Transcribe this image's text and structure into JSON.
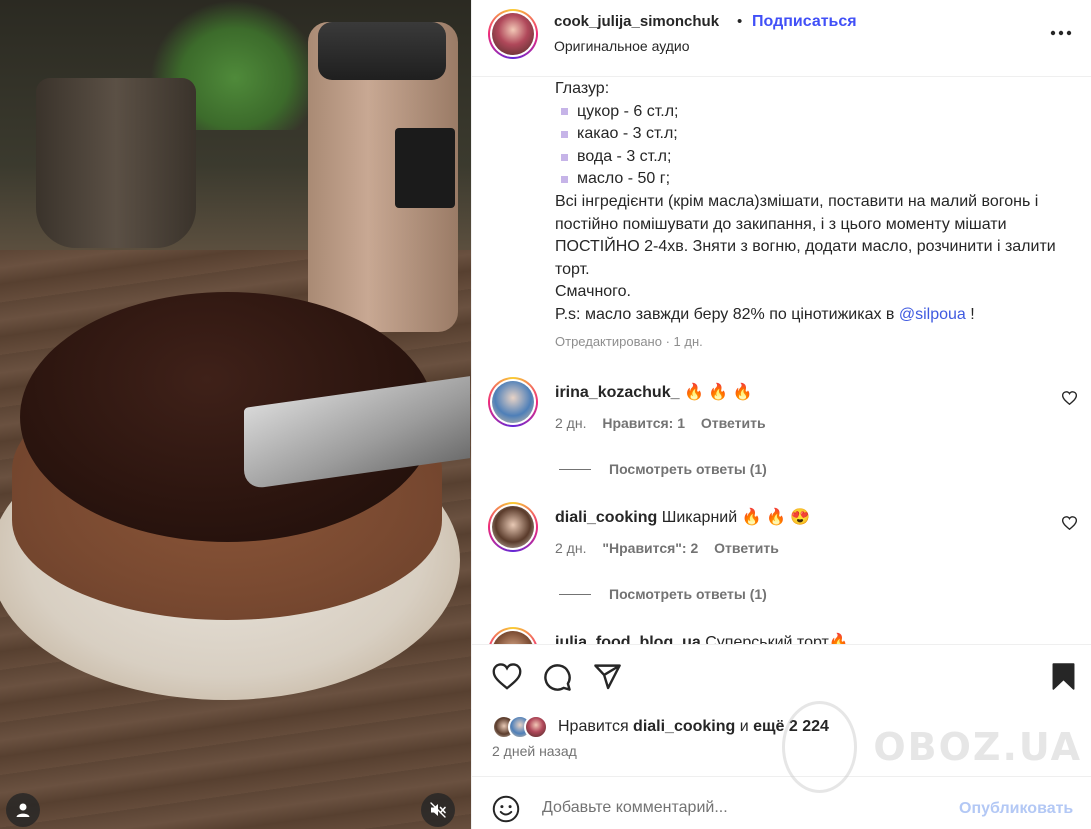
{
  "media": {
    "user_icon": "user-icon",
    "mute_icon": "muted-speaker-icon"
  },
  "header": {
    "username": "cook_julija_simonchuk",
    "separator": "•",
    "subscribe_label": "Подписаться",
    "audio_label": "Оригинальное аудио",
    "more_icon": "more-horizontal-icon"
  },
  "caption": {
    "glaze_title": "Глазур:",
    "ingredients": [
      "цукор - 6 ст.л;",
      "какао - 3 ст.л;",
      "вода - 3 ст.л;",
      "масло - 50 г;"
    ],
    "instructions": "Всі інгредієнти (крім масла)змішати, поставити на малий вогонь і постійно помішувати до закипання, і з цього моменту мішати ПОСТІЙНО 2-4хв. Зняти з вогню, додати масло, розчинити і залити торт.",
    "closing": "Смачного.",
    "ps_prefix": "P.s: масло завжди беру 82% по цінотижиках в ",
    "ps_mention": "@silpoua",
    "ps_suffix": " !",
    "edited": "Отредактировано · 1 дн."
  },
  "comments": [
    {
      "username": "irina_kozachuk_",
      "text": "🔥 🔥 🔥",
      "time": "2 дн.",
      "likes": "Нравится: 1",
      "reply": "Ответить",
      "view_replies": "Посмотреть ответы (1)"
    },
    {
      "username": "diali_cooking",
      "text": "Шикарний 🔥 🔥 😍",
      "time": "2 дн.",
      "likes": "\"Нравится\": 2",
      "reply": "Ответить",
      "view_replies": "Посмотреть ответы (1)"
    },
    {
      "username": "julia_food_blog_ua",
      "text": "Суперський торт🔥"
    }
  ],
  "actions": {
    "like_icon": "heart-icon",
    "comment_icon": "comment-icon",
    "share_icon": "send-icon",
    "save_icon": "bookmark-icon",
    "likes_prefix": "Нравится ",
    "likes_user": "diali_cooking",
    "likes_mid": " и ",
    "likes_rest": "ещё 2 224",
    "date": "2 дней назад"
  },
  "add_comment": {
    "placeholder": "Добавьте комментарий...",
    "publish_label": "Опубликовать",
    "emoji_icon": "emoji-icon"
  },
  "watermark": {
    "text": "OBOZ.UA"
  },
  "colors": {
    "link_blue": "#4150f7",
    "mention_blue": "#3f5ae0",
    "publish_disabled": "#b3c8f5",
    "text_primary": "#262626",
    "text_secondary": "#737373"
  }
}
